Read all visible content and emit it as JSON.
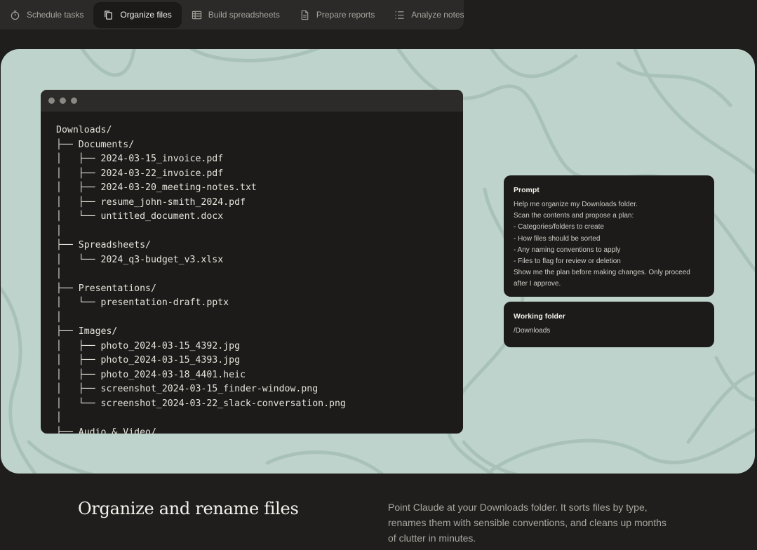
{
  "tabs": [
    {
      "label": "Schedule tasks",
      "icon": "timer-icon",
      "active": false
    },
    {
      "label": "Organize files",
      "icon": "copy-files-icon",
      "active": true
    },
    {
      "label": "Build spreadsheets",
      "icon": "table-icon",
      "active": false
    },
    {
      "label": "Prepare reports",
      "icon": "document-icon",
      "active": false
    },
    {
      "label": "Analyze notes",
      "icon": "list-icon",
      "active": false
    }
  ],
  "terminal": {
    "lines": [
      "Downloads/",
      "├── Documents/",
      "│   ├── 2024-03-15_invoice.pdf",
      "│   ├── 2024-03-22_invoice.pdf",
      "│   ├── 2024-03-20_meeting-notes.txt",
      "│   ├── resume_john-smith_2024.pdf",
      "│   └── untitled_document.docx",
      "│",
      "├── Spreadsheets/",
      "│   └── 2024_q3-budget_v3.xlsx",
      "│",
      "├── Presentations/",
      "│   └── presentation-draft.pptx",
      "│",
      "├── Images/",
      "│   ├── photo_2024-03-15_4392.jpg",
      "│   ├── photo_2024-03-15_4393.jpg",
      "│   ├── photo_2024-03-18_4401.heic",
      "│   ├── screenshot_2024-03-15_finder-window.png",
      "│   └── screenshot_2024-03-22_slack-conversation.png",
      "│",
      "├── Audio & Video/"
    ]
  },
  "prompt_card": {
    "title": "Prompt",
    "lines": [
      "Help me organize my Downloads folder.",
      "Scan the contents and propose a plan:",
      "- Categories/folders to create",
      "- How files should be sorted",
      "- Any naming conventions to apply",
      "- Files to flag for review or deletion",
      "Show me the plan before making changes. Only proceed",
      "after I approve."
    ]
  },
  "folder_card": {
    "title": "Working folder",
    "value": "/Downloads"
  },
  "section": {
    "title": "Organize and rename files",
    "description_lines": [
      "Point Claude at your Downloads folder. It sorts files by type,",
      "renames them with sensible conventions, and cleans up months",
      "of clutter in minutes."
    ]
  },
  "colors": {
    "page_bg": "#1f1e1d",
    "tabbar_bg": "#2b2a28",
    "hero_bg": "#bed3cb",
    "terminal_bg": "#1c1b1a"
  }
}
